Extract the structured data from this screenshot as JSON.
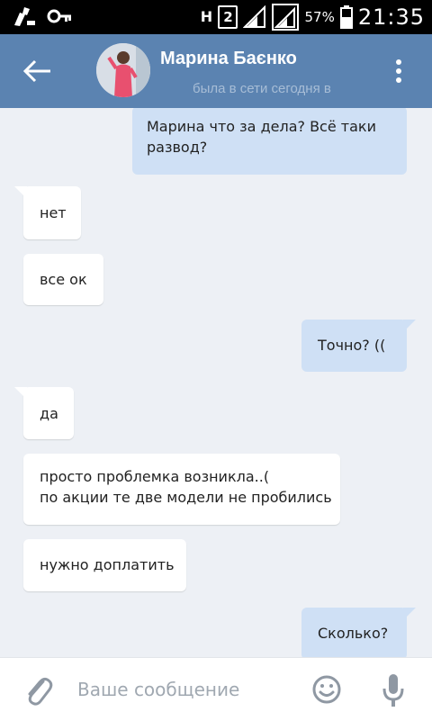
{
  "status_bar": {
    "network": "H",
    "sim": "2",
    "battery": "57%",
    "time": "21:35"
  },
  "header": {
    "contact_name": "Марина Баєнко",
    "status": "была в сети сегодня в"
  },
  "messages": [
    {
      "direction": "out",
      "text": "Марина что за дела? Всё таки\nразвод?"
    },
    {
      "direction": "in",
      "text": "нет"
    },
    {
      "direction": "in",
      "text": "все ок"
    },
    {
      "direction": "out",
      "text": "Точно? (("
    },
    {
      "direction": "in",
      "text": "да"
    },
    {
      "direction": "in",
      "text": "просто проблемка возникла..(\nпо акции те две модели не пробились"
    },
    {
      "direction": "in",
      "text": "нужно доплатить"
    },
    {
      "direction": "out",
      "text": "Сколько?"
    }
  ],
  "composer": {
    "placeholder": "Ваше сообщение"
  },
  "colors": {
    "header": "#5b83b1",
    "background": "#edf0f5",
    "outgoing_bubble": "#cfe0f5",
    "incoming_bubble": "#ffffff"
  }
}
